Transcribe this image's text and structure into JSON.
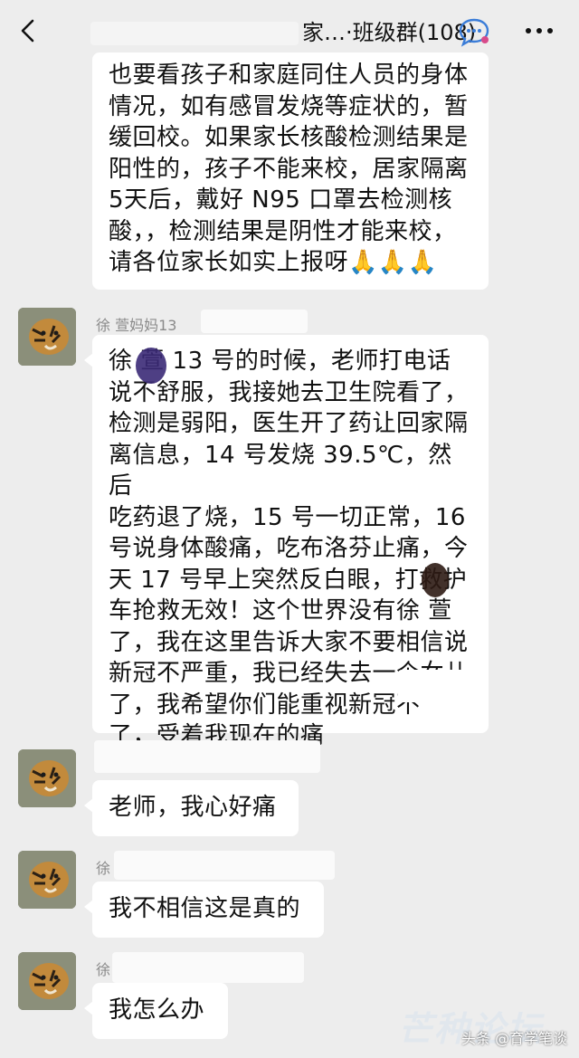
{
  "header": {
    "title_prefix": "家…",
    "title_suffix": "·班级群(108)"
  },
  "messages": [
    {
      "sender": "",
      "lines": [
        "也要看孩子和家庭同住人员的身体",
        "情况，如有感冒发烧等症状的，暂",
        "缓回校。如果家长核酸检测结果是",
        "阳性的，孩子不能来校，居家隔离",
        "5天后，戴好 N95 口罩去检测核",
        "酸，，检测结果是阴性才能来校，",
        "请各位家长如实上报呀🙏🙏🙏"
      ]
    },
    {
      "sender": "徐 萱妈妈13",
      "lines": [
        "徐 萱 13 号的时候，老师打电话",
        "说不舒服，我接她去卫生院看了，",
        "检测是弱阳，医生开了药让回家隔",
        "离信息，14 号发烧 39.5℃，然后",
        "吃药退了烧，15 号一切正常，16",
        "号说身体酸痛，吃布洛芬止痛，今",
        "天 17 号早上突然反白眼，打救护",
        "车抢救无效！这个世界没有徐 萱",
        "了，我在这里告诉大家不要相信说",
        "新冠不严重，我已经失去一个女儿",
        "了，我希望你们能重视新冠不",
        "  了，受着我现在的痛"
      ]
    },
    {
      "sender": "",
      "lines": [
        "老师，我心好痛"
      ]
    },
    {
      "sender": "徐",
      "lines": [
        "我不相信这是真的"
      ]
    },
    {
      "sender": "徐",
      "lines": [
        "我怎么办"
      ]
    }
  ],
  "watermark": "头条 @育学笔谈",
  "faint_mark": "芒种论坛"
}
